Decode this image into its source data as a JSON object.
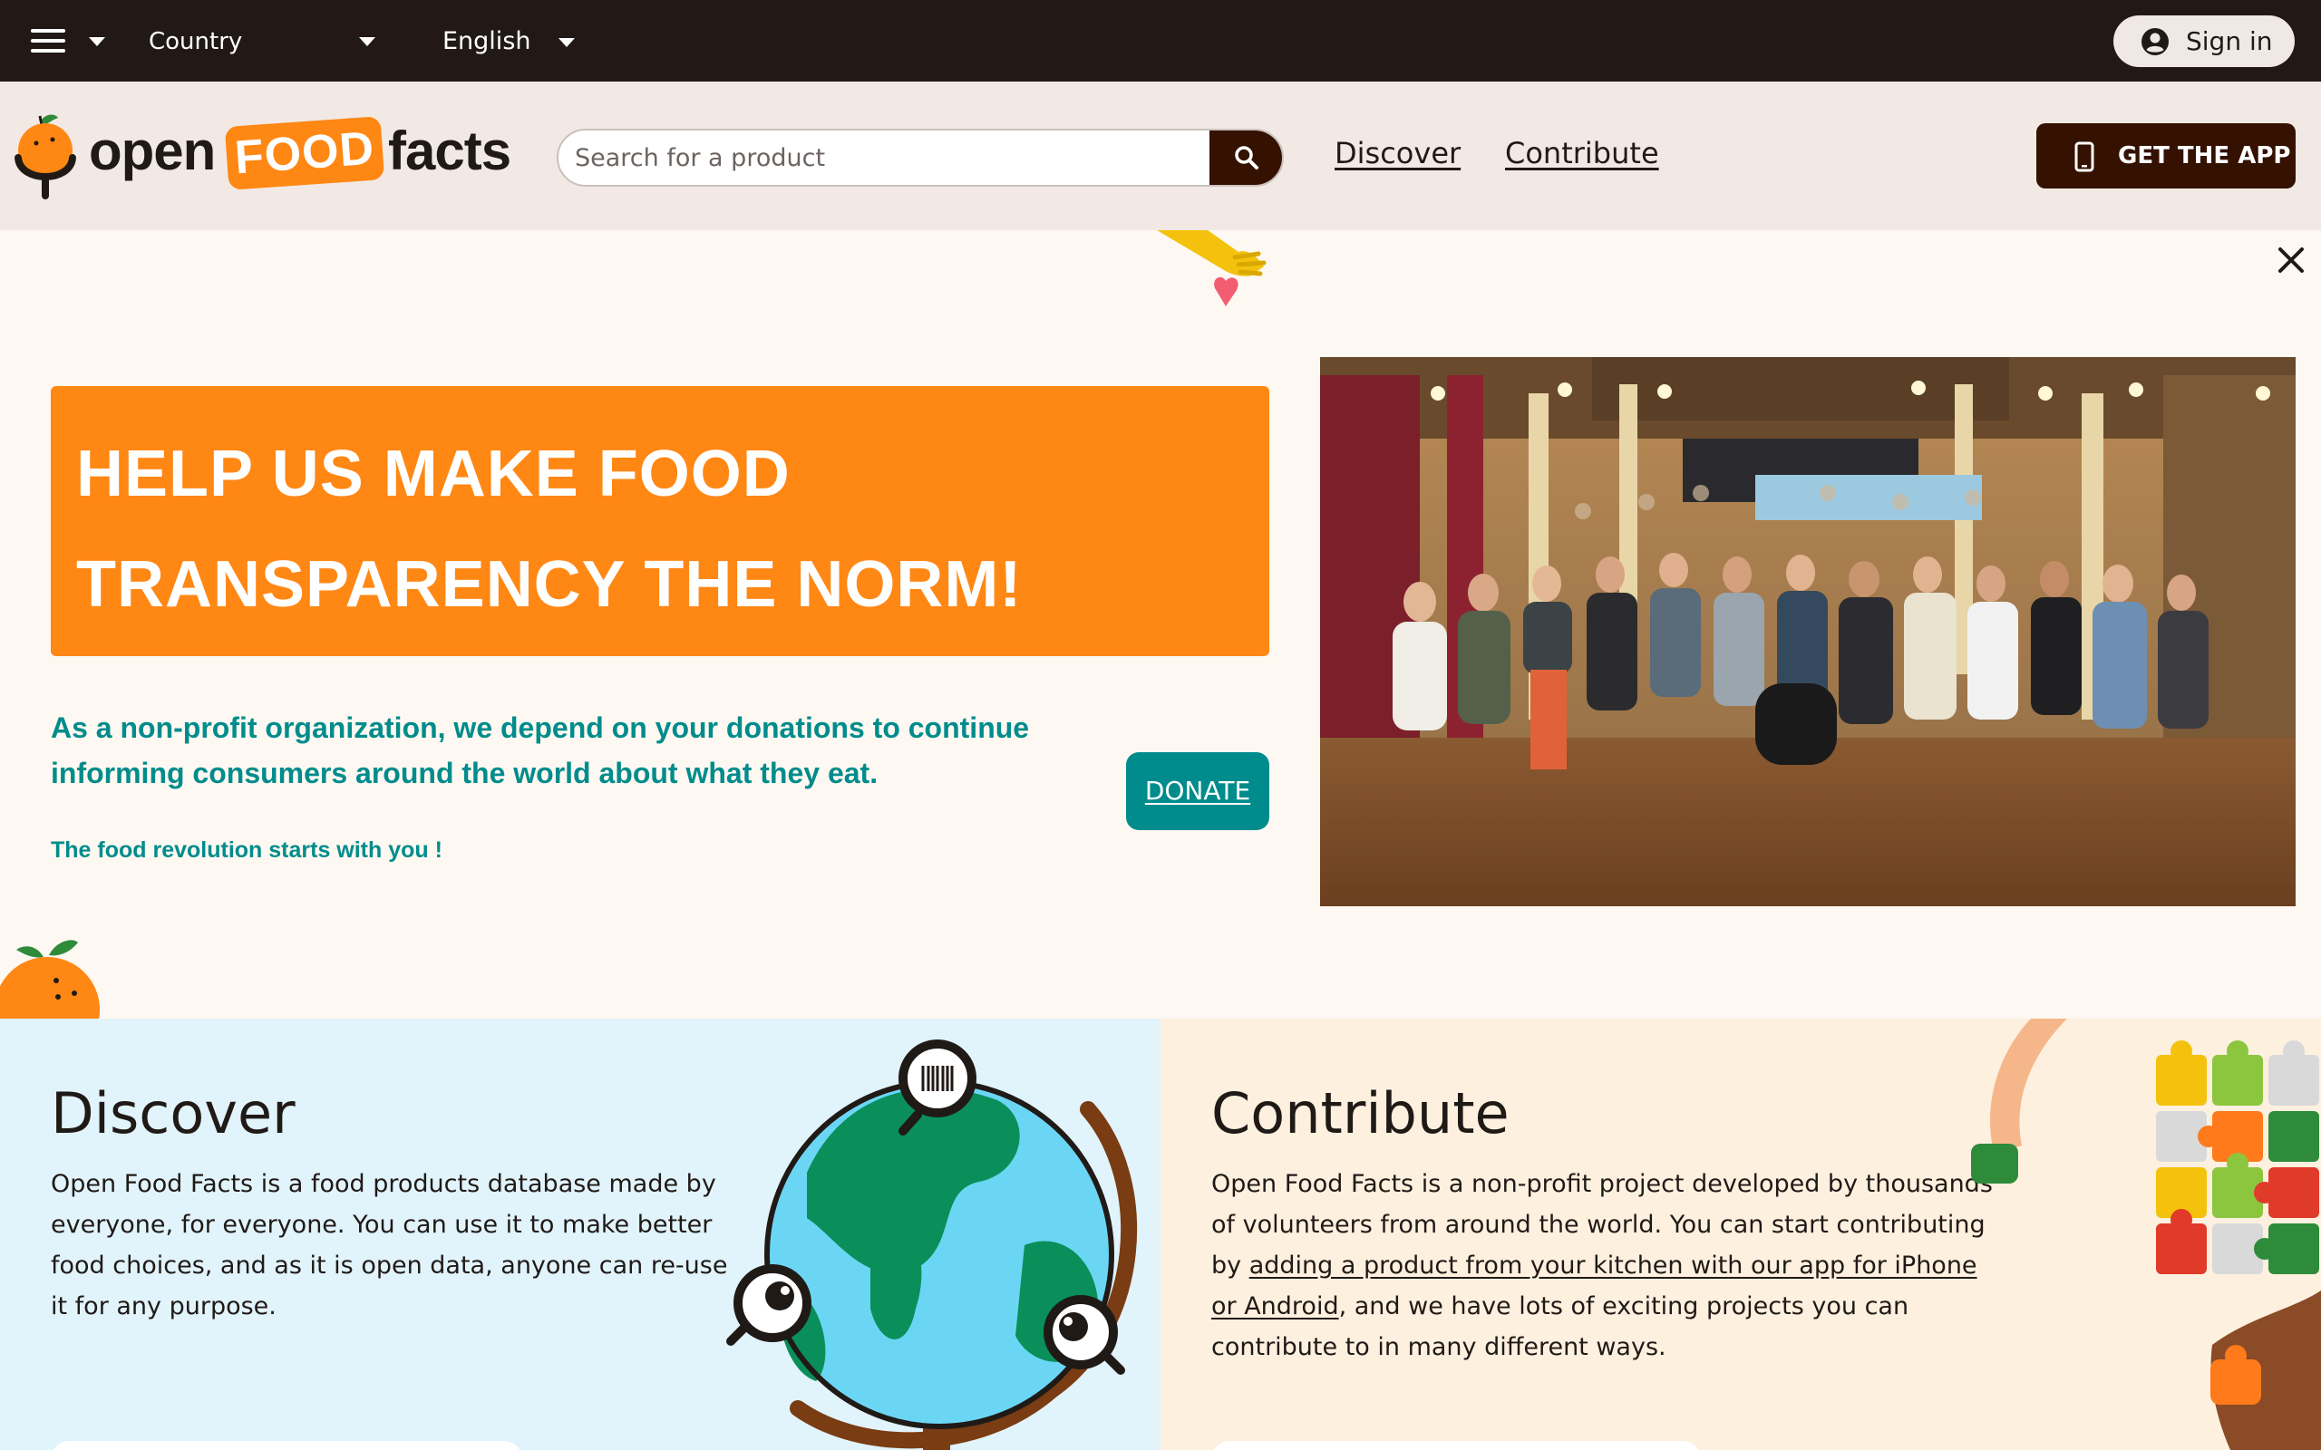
{
  "topbar": {
    "country_label": "Country",
    "language_label": "English",
    "signin_label": "Sign in"
  },
  "header": {
    "logo": {
      "word1": "open",
      "word2": "FOOD",
      "word3": "facts"
    },
    "search_placeholder": "Search for a product",
    "nav": {
      "discover": "Discover",
      "contribute": "Contribute"
    },
    "get_app_label": "GET THE APP"
  },
  "banner": {
    "headline_line1": "HELP US MAKE FOOD",
    "headline_line2": "TRANSPARENCY THE NORM!",
    "text": "As a non-profit organization, we depend on your donations to continue informing consumers around the world about what they eat.",
    "tagline": "The food revolution starts with you !",
    "donate_label": "DONATE"
  },
  "discover": {
    "title": "Discover",
    "body": "Open Food Facts is a food products database made by everyone, for everyone. You can use it to make better food choices, and as it is open data, anyone can re-use it for any purpose."
  },
  "contribute": {
    "title": "Contribute",
    "body_start": "Open Food Facts is a non-profit project developed by thousands of volunteers from around the world. You can start contributing by ",
    "body_link": "adding a product from your kitchen with our app for iPhone or Android",
    "body_end": ", and we have lots of exciting projects you can contribute to in many different ways."
  },
  "colors": {
    "dark": "#221917",
    "brown": "#341100",
    "orange": "#ff8714",
    "teal": "#008c8c",
    "discover_bg": "#e1f3fb",
    "contribute_bg": "#fef0df"
  }
}
